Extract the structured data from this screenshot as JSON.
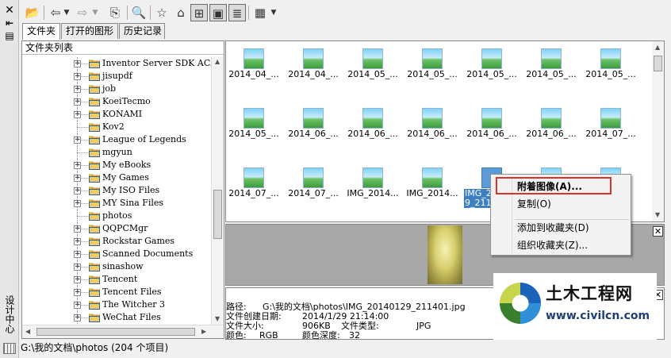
{
  "window": {
    "side_title": "设计中心"
  },
  "toolbar": {
    "icons": [
      "open-folder-icon",
      "back-icon",
      "dropdown-icon",
      "forward-icon",
      "dropdown-icon",
      "up-folder-icon",
      "search-icon",
      "favorites-icon",
      "home-icon",
      "tree-toggle-icon",
      "preview-toggle-icon",
      "description-toggle-icon",
      "views-icon",
      "dropdown-icon"
    ]
  },
  "tabs": [
    {
      "label": "文件夹",
      "active": true
    },
    {
      "label": "打开的图形",
      "active": false
    },
    {
      "label": "历史记录",
      "active": false
    }
  ],
  "tree": {
    "header": "文件夹列表",
    "items": [
      {
        "label": "Inventor Server SDK ACA",
        "expandable": true
      },
      {
        "label": "jisupdf",
        "expandable": true
      },
      {
        "label": "job",
        "expandable": true
      },
      {
        "label": "KoeiTecmo",
        "expandable": true
      },
      {
        "label": "KONAMI",
        "expandable": true
      },
      {
        "label": "Kov2",
        "expandable": false
      },
      {
        "label": "League of Legends",
        "expandable": true
      },
      {
        "label": "mgyun",
        "expandable": false
      },
      {
        "label": "My eBooks",
        "expandable": true
      },
      {
        "label": "My Games",
        "expandable": true
      },
      {
        "label": "My ISO Files",
        "expandable": true
      },
      {
        "label": "MY Sina Files",
        "expandable": true
      },
      {
        "label": "photos",
        "expandable": false
      },
      {
        "label": "QQPCMgr",
        "expandable": true
      },
      {
        "label": "Rockstar Games",
        "expandable": true
      },
      {
        "label": "Scanned Documents",
        "expandable": true
      },
      {
        "label": "sinashow",
        "expandable": true
      },
      {
        "label": "Tencent",
        "expandable": true
      },
      {
        "label": "Tencent Files",
        "expandable": true
      },
      {
        "label": "The Witcher 3",
        "expandable": true
      },
      {
        "label": "WeChat Files",
        "expandable": true
      }
    ]
  },
  "thumbnails": [
    {
      "caption": "2014_04_...",
      "selected": false
    },
    {
      "caption": "2014_04_...",
      "selected": false
    },
    {
      "caption": "2014_05_...",
      "selected": false
    },
    {
      "caption": "2014_05_...",
      "selected": false
    },
    {
      "caption": "2014_05_...",
      "selected": false
    },
    {
      "caption": "2014_05_...",
      "selected": false
    },
    {
      "caption": "2014_05_...",
      "selected": false
    },
    {
      "caption": "2014_05_...",
      "selected": false
    },
    {
      "caption": "2014_06_...",
      "selected": false
    },
    {
      "caption": "2014_06_...",
      "selected": false
    },
    {
      "caption": "2014_06_...",
      "selected": false
    },
    {
      "caption": "2014_06_...",
      "selected": false
    },
    {
      "caption": "2014_06_...",
      "selected": false
    },
    {
      "caption": "2014_07_...",
      "selected": false
    },
    {
      "caption": "2014_07_...",
      "selected": false
    },
    {
      "caption": "2014_07_...",
      "selected": false
    },
    {
      "caption": "IMG_2014...",
      "selected": false
    },
    {
      "caption": "IMG_2014...",
      "selected": false
    },
    {
      "caption": "IMG_2 9_211",
      "selected": true
    },
    {
      "caption": "",
      "selected": false
    },
    {
      "caption": "",
      "selected": false
    }
  ],
  "details": {
    "path_label": "路径:",
    "path_value": "G:\\我的文档\\photos\\IMG_20140129_211401.jpg",
    "created_label": "文件创建日期:",
    "created_value": "2014/1/29 21:14:00",
    "size_label": "文件大小:",
    "size_value": "906KB",
    "type_label": "文件类型:",
    "type_value": "JPG",
    "color_label": "颜色:",
    "color_value": "RGB",
    "depth_label": "颜色深度:",
    "depth_value": "32"
  },
  "statusbar": {
    "text": "G:\\我的文档\\photos (204 个项目)"
  },
  "context_menu": {
    "items": [
      {
        "label": "附着图像(A)...",
        "bold": true
      },
      {
        "label": "复制(O)",
        "bold": false
      },
      {
        "label": "添加到收藏夹(D)",
        "bold": false
      },
      {
        "label": "组织收藏夹(Z)...",
        "bold": false
      }
    ],
    "highlight_color": "#d9342b"
  },
  "watermark": {
    "title": "土木工程网",
    "url": "www.civilcn.com"
  },
  "colors": {
    "selection": "#3d7fc1",
    "folder": "#e8b73a"
  }
}
